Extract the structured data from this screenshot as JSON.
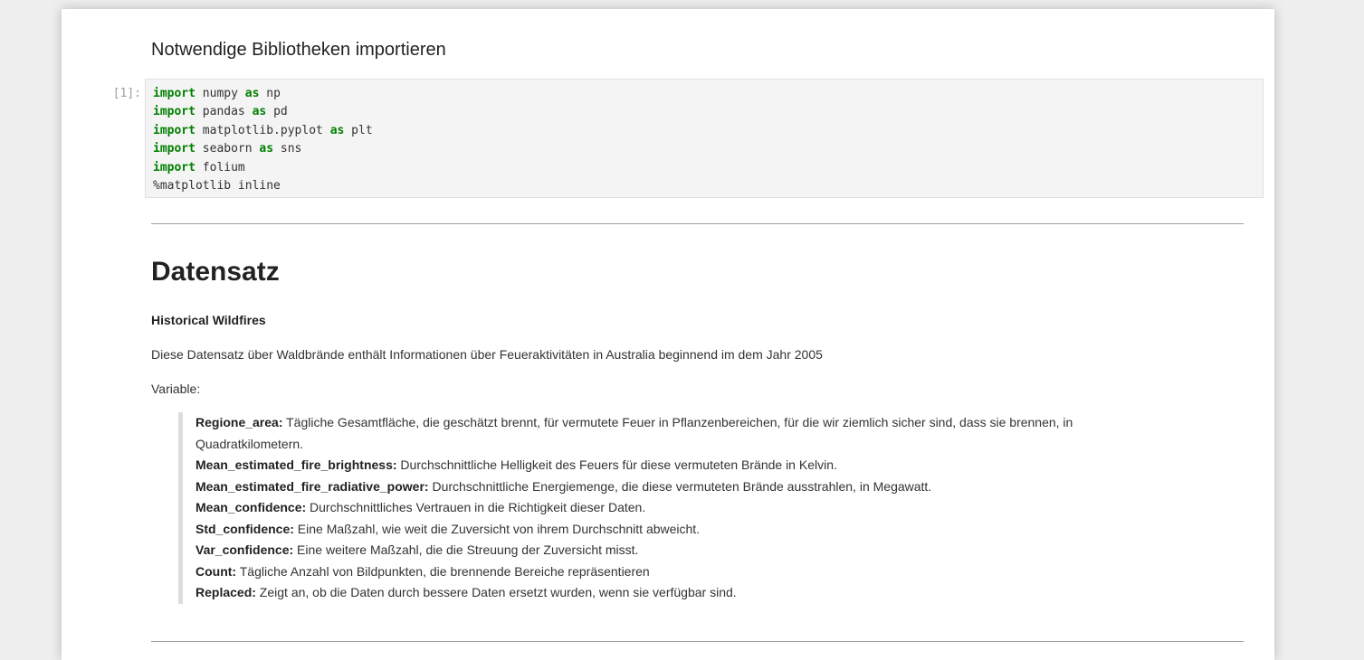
{
  "section_heading": "Notwendige Bibliotheken importieren",
  "code_cell": {
    "prompt": "[1]:",
    "lines": [
      {
        "kw1": "import",
        "mod": " numpy ",
        "kw2": "as",
        "alias": " np"
      },
      {
        "kw1": "import",
        "mod": " pandas ",
        "kw2": "as",
        "alias": " pd"
      },
      {
        "kw1": "import",
        "mod": " matplotlib.pyplot ",
        "kw2": "as",
        "alias": " plt"
      },
      {
        "kw1": "import",
        "mod": " seaborn ",
        "kw2": "as",
        "alias": " sns"
      },
      {
        "kw1": "import",
        "mod": " folium",
        "kw2": "",
        "alias": ""
      },
      {
        "kw1": "",
        "mod": "%matplotlib inline",
        "kw2": "",
        "alias": ""
      }
    ]
  },
  "dataset": {
    "title": "Datensatz",
    "subtitle": "Historical Wildfires",
    "description": "Diese Datensatz über Waldbrände enthält Informationen über Feueraktivitäten in Australia beginnend im dem Jahr 2005",
    "variables_label": "Variable:",
    "variables": [
      {
        "term": "Regione_area:",
        "desc": " Tägliche Gesamtfläche, die geschätzt brennt, für vermutete Feuer in Pflanzenbereichen, für die wir ziemlich sicher sind, dass sie brennen, in Quadratkilometern."
      },
      {
        "term": "Mean_estimated_fire_brightness:",
        "desc": " Durchschnittliche Helligkeit des Feuers für diese vermuteten Brände in Kelvin."
      },
      {
        "term": "Mean_estimated_fire_radiative_power:",
        "desc": " Durchschnittliche Energiemenge, die diese vermuteten Brände ausstrahlen, in Megawatt."
      },
      {
        "term": "Mean_confidence:",
        "desc": " Durchschnittliches Vertrauen in die Richtigkeit dieser Daten."
      },
      {
        "term": "Std_confidence:",
        "desc": " Eine Maßzahl, wie weit die Zuversicht von ihrem Durchschnitt abweicht."
      },
      {
        "term": "Var_confidence:",
        "desc": " Eine weitere Maßzahl, die die Streuung der Zuversicht misst."
      },
      {
        "term": "Count:",
        "desc": " Tägliche Anzahl von Bildpunkten, die brennende Bereiche repräsentieren"
      },
      {
        "term": "Replaced:",
        "desc": " Zeigt an, ob die Daten durch bessere Daten ersetzt wurden, wenn sie verfügbar sind."
      }
    ]
  },
  "colors": {
    "page_background": "#eeeeee",
    "cell_background": "#f4f4f4",
    "keyword": "#008000",
    "prompt": "#9e9e9e",
    "text": "#333333"
  }
}
